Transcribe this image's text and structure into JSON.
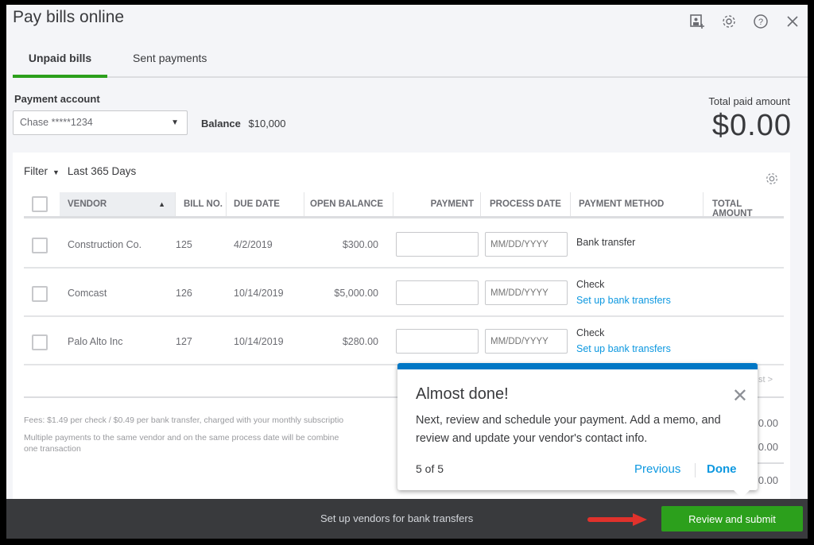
{
  "window": {
    "title": "Pay bills online",
    "icons": [
      "add-contact-icon",
      "gear-icon",
      "help-icon",
      "close-icon"
    ]
  },
  "tabs": [
    {
      "label": "Unpaid bills",
      "active": true
    },
    {
      "label": "Sent payments",
      "active": false
    }
  ],
  "payment_account": {
    "label": "Payment account",
    "selected": "Chase *****1234",
    "balance_label": "Balance",
    "balance_value": "$10,000"
  },
  "total": {
    "label": "Total paid amount",
    "value": "$0.00"
  },
  "filter": {
    "label": "Filter",
    "value": "Last 365 Days"
  },
  "table": {
    "columns": [
      "VENDOR",
      "BILL NO.",
      "DUE DATE",
      "OPEN BALANCE",
      "PAYMENT",
      "PROCESS DATE",
      "PAYMENT METHOD",
      "TOTAL AMOUNT"
    ],
    "date_placeholder": "MM/DD/YYYY",
    "rows": [
      {
        "vendor": "Construction Co.",
        "bill_no": "125",
        "due_date": "4/2/2019",
        "open_balance": "$300.00",
        "payment": "",
        "method": "Bank transfer",
        "method_link": ""
      },
      {
        "vendor": "Comcast",
        "bill_no": "126",
        "due_date": "10/14/2019",
        "open_balance": "$5,000.00",
        "payment": "",
        "method": "Check",
        "method_link": "Set up bank transfers"
      },
      {
        "vendor": "Palo Alto Inc",
        "bill_no": "127",
        "due_date": "10/14/2019",
        "open_balance": "$280.00",
        "payment": "",
        "method": "Check",
        "method_link": "Set up bank transfers"
      }
    ],
    "pagination_fragment": "st >"
  },
  "notes": {
    "fees": "Fees: $1.49 per check / $0.49 per bank transfer, charged with your monthly subscriptio",
    "combined": "Multiple payments to the same vendor and on the same process date will be combine",
    "combined_2": "one transaction"
  },
  "totals_fragments": [
    "0.00",
    "0.00",
    "0.00"
  ],
  "popup": {
    "title": "Almost done!",
    "body": "Next, review and schedule your payment. Add a memo, and review and update your vendor's contact info.",
    "step": "5 of 5",
    "previous_label": "Previous",
    "done_label": "Done",
    "accent": "#0077c5"
  },
  "footer": {
    "setup_link": "Set up vendors for bank transfers",
    "review_button": "Review and submit",
    "button_color": "#2ca01c"
  }
}
